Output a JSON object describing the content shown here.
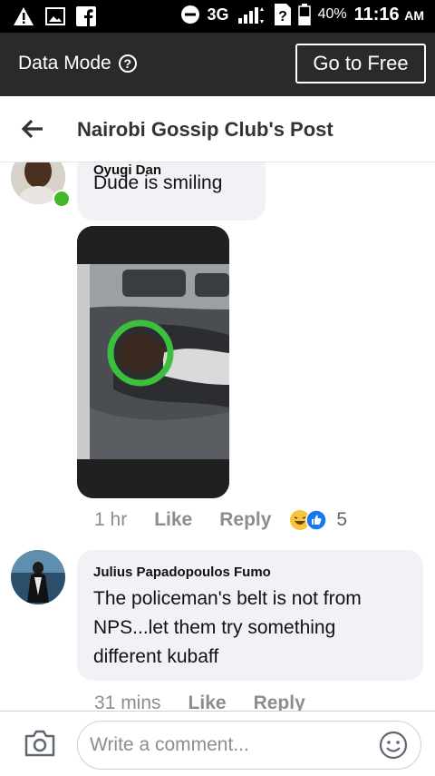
{
  "status_bar": {
    "network": "3G",
    "battery": "40%",
    "time": "11:16",
    "ampm": "AM",
    "icons": [
      "alert-icon",
      "image-icon",
      "facebook-icon",
      "minus-circle-icon",
      "signal-icon",
      "unknown-sim-icon",
      "battery-icon"
    ]
  },
  "data_mode": {
    "label": "Data Mode",
    "help": "?",
    "go_free": "Go to Free"
  },
  "header": {
    "title": "Nairobi Gossip Club's Post"
  },
  "comments": [
    {
      "name": "Oyugi Dan",
      "text": "Dude is smiling",
      "time": "1 hr",
      "like": "Like",
      "reply": "Reply",
      "reaction_count": "5",
      "online": true
    },
    {
      "name": "Julius Papadopoulos Fumo",
      "text_lines": [
        "The policeman's belt is not from",
        "NPS...let them try something",
        "different kubaff"
      ],
      "time": "31 mins",
      "like": "Like",
      "reply": "Reply"
    }
  ],
  "composer": {
    "placeholder": "Write a comment..."
  },
  "colors": {
    "online": "#42b72a",
    "bubble": "#f0f2f5",
    "bar": "#2a2a2a",
    "highlight_circle": "#3cbf3c"
  }
}
